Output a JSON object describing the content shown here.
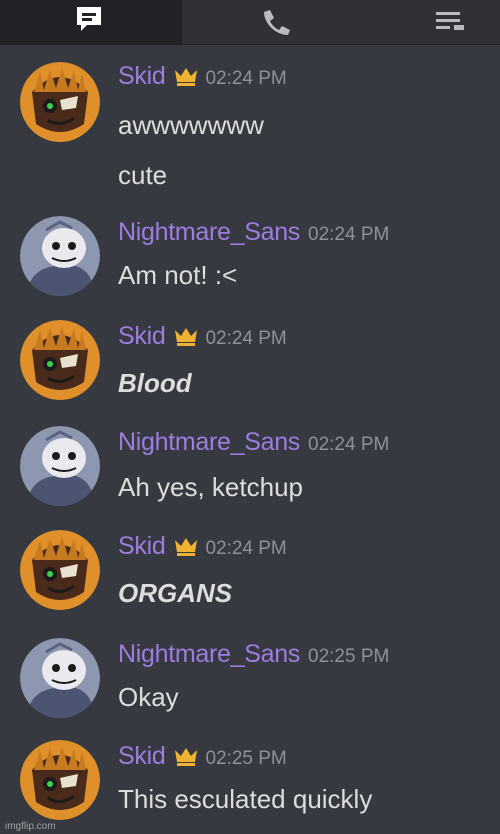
{
  "topbar": {
    "tabs": [
      {
        "name": "chat",
        "icon": "chat-icon",
        "active": true
      },
      {
        "name": "call",
        "icon": "phone-icon",
        "active": false
      },
      {
        "name": "members",
        "icon": "list-icon",
        "active": false
      }
    ]
  },
  "colors": {
    "background": "#36393f",
    "topbar": "#2f3136",
    "username": "#9d7de0",
    "text": "#dcddde",
    "timestamp": "#8e9297",
    "crown": "#f0b232"
  },
  "messages": [
    {
      "author": "Skid",
      "owner": true,
      "time": "02:24 PM",
      "lines": [
        "awwwwwww",
        "cute"
      ],
      "style": "normal"
    },
    {
      "author": "Nightmare_Sans",
      "owner": false,
      "time": "02:24 PM",
      "lines": [
        "Am not! :<"
      ],
      "style": "normal"
    },
    {
      "author": "Skid",
      "owner": true,
      "time": "02:24 PM",
      "lines": [
        "Blood"
      ],
      "style": "bold-italic"
    },
    {
      "author": "Nightmare_Sans",
      "owner": false,
      "time": "02:24 PM",
      "lines": [
        "Ah yes, ketchup"
      ],
      "style": "normal"
    },
    {
      "author": "Skid",
      "owner": true,
      "time": "02:24 PM",
      "lines": [
        "ORGANS"
      ],
      "style": "bold-italic"
    },
    {
      "author": "Nightmare_Sans",
      "owner": false,
      "time": "02:25 PM",
      "lines": [
        "Okay"
      ],
      "style": "normal"
    },
    {
      "author": "Skid",
      "owner": true,
      "time": "02:25 PM",
      "lines": [
        "This esculated quickly"
      ],
      "style": "normal"
    }
  ],
  "watermark": "imgflip.com"
}
